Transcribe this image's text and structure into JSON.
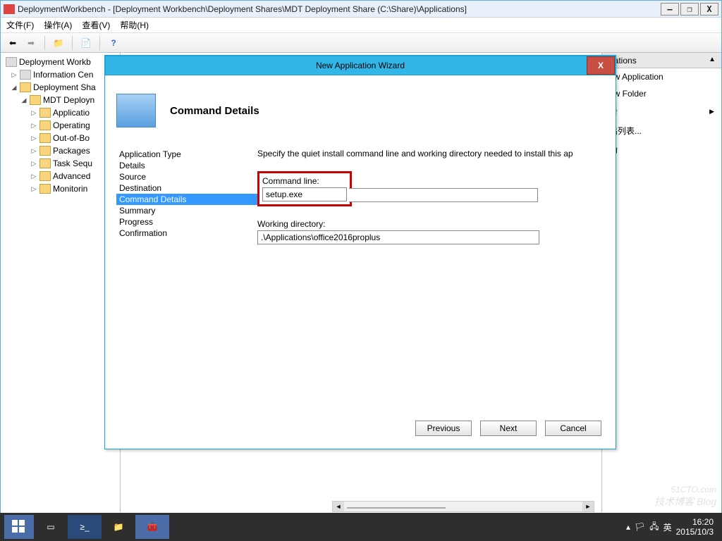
{
  "window": {
    "title": "DeploymentWorkbench - [Deployment Workbench\\Deployment Shares\\MDT Deployment Share (C:\\Share)\\Applications]",
    "minimize": "—",
    "maximize": "❐",
    "close": "X"
  },
  "menubar": {
    "file": "文件(F)",
    "action": "操作(A)",
    "view": "查看(V)",
    "help": "帮助(H)"
  },
  "tree": {
    "root": "Deployment Workb",
    "info_center": "Information Cen",
    "deploy_shares": "Deployment Sha",
    "mdt_share": "MDT Deployn",
    "applications": "Applicatio",
    "operating": "Operating",
    "oob": "Out-of-Bo",
    "packages": "Packages",
    "taskseq": "Task Sequ",
    "advanced": "Advanced",
    "monitoring": "Monitorin"
  },
  "actions": {
    "header": "ications",
    "new_app": "ew Application",
    "new_folder": "ew Folder",
    "view": "看",
    "export": "出列表...",
    "help": "助"
  },
  "wizard": {
    "title": "New Application Wizard",
    "heading": "Command Details",
    "steps": {
      "app_type": "Application Type",
      "details": "Details",
      "source": "Source",
      "destination": "Destination",
      "command_details": "Command Details",
      "summary": "Summary",
      "progress": "Progress",
      "confirmation": "Confirmation"
    },
    "instruction": "Specify the quiet install command line and working directory needed to install this ap",
    "cmd_label": "Command line:",
    "cmd_value": "setup.exe",
    "workdir_label": "Working directory:",
    "workdir_value": ".\\Applications\\office2016proplus",
    "btn_prev": "Previous",
    "btn_next": "Next",
    "btn_cancel": "Cancel"
  },
  "taskbar": {
    "time": "16:20",
    "date": "2015/10/3",
    "ime": "英"
  },
  "watermark": {
    "top": "51CTO.com",
    "sub": "技术博客  Blog"
  }
}
